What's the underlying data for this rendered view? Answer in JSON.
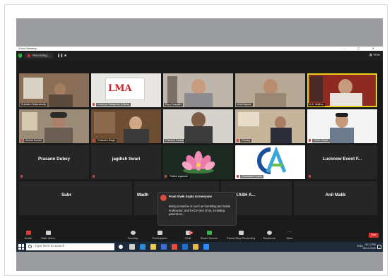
{
  "window": {
    "title": "Zoom Meeting",
    "controls": "–  ▢  ✕"
  },
  "top_bar": {
    "recording_label": "Recording...",
    "pause": "❚❚",
    "stop": "■",
    "view_label": "▦ View"
  },
  "participants": [
    {
      "name": "Subrata Chakraborty",
      "type": "video"
    },
    {
      "name": "Lavanya Sangeeta (Nisha)",
      "type": "video"
    },
    {
      "name": "Ravi Prakash",
      "type": "video"
    },
    {
      "name": "Anil Kapoor",
      "type": "video"
    },
    {
      "name": "A.K. Mathur",
      "type": "video"
    },
    {
      "name": "Arvind Kumar",
      "type": "video"
    },
    {
      "name": "Chandra Singh",
      "type": "video"
    },
    {
      "name": "Praveen Kumar",
      "type": "video"
    },
    {
      "name": "Pankaj",
      "type": "video"
    },
    {
      "name": "Vivek Gupta",
      "type": "video"
    },
    {
      "name": "Prasann Dubey",
      "type": "name"
    },
    {
      "name": "jagdish tiwari",
      "type": "name"
    },
    {
      "name": "Pallavi Agarwal",
      "type": "video"
    },
    {
      "name": "Devanand Gupta",
      "type": "video"
    },
    {
      "name": "Lucknow Event F...",
      "type": "name"
    },
    {
      "name": "Subr",
      "type": "name"
    },
    {
      "name": "Madh",
      "type": "name"
    },
    {
      "name": "M PRAKASH A...",
      "type": "name"
    },
    {
      "name": "Anil Malik",
      "type": "name"
    }
  ],
  "chat_popup": {
    "from": "From Vivek Gupta to Everyone",
    "message": "Being a teacher is such an humbling and noble endeavour, and EACH one of us, including parents et..."
  },
  "toolbar": {
    "items": [
      {
        "label": "Audio",
        "icon": "microphone-icon"
      },
      {
        "label": "Start Video",
        "icon": "video-camera-icon"
      },
      {
        "label": "Security",
        "icon": "shield-icon"
      },
      {
        "label": "Participants",
        "icon": "participants-icon",
        "count": "21"
      },
      {
        "label": "Chat",
        "icon": "chat-icon",
        "badge": "99"
      },
      {
        "label": "Share Screen",
        "icon": "share-screen-icon"
      },
      {
        "label": "Pause/Stop Recording",
        "icon": "record-icon"
      },
      {
        "label": "Reactions",
        "icon": "smiley-icon"
      },
      {
        "label": "More",
        "icon": "more-icon"
      }
    ],
    "end_label": "End"
  },
  "taskbar": {
    "search_placeholder": "Type here to search",
    "tray_text": "ENG",
    "time": "06:13 PM",
    "date": "28-12-2020"
  },
  "colors": {
    "active_speaker": "#e5d21a",
    "end_button": "#d83232",
    "share_screen": "#2fb54a"
  }
}
